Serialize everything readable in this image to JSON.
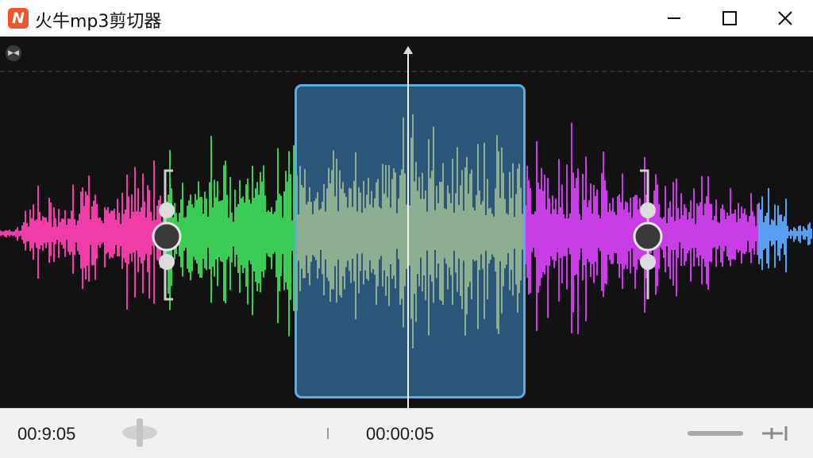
{
  "window": {
    "title": "火牛mp3剪切器",
    "logo_letter": "N"
  },
  "controls": {
    "minimize": "minimize-icon",
    "maximize": "maximize-icon",
    "close": "close-icon"
  },
  "waveform": {
    "colors": [
      "#ff3fb0",
      "#3ed65a",
      "#f6e24a",
      "#d240f2",
      "#5aa7ff"
    ],
    "selection_color": "#4a8ed0"
  },
  "timeline": {
    "start_time": "00:9:05",
    "current_time": "00:00:05"
  },
  "icons": {
    "corner": "audio-channel-icon",
    "scrub": "scrub-handle-icon",
    "zoom": "zoom-slider",
    "fit": "fit-to-end-icon"
  }
}
